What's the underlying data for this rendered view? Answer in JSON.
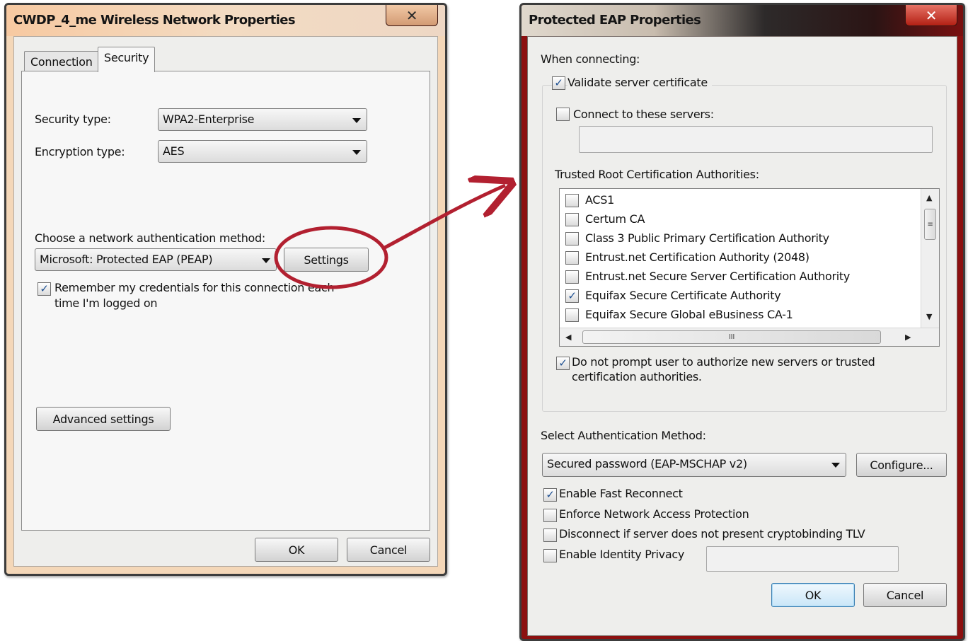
{
  "left_dialog": {
    "title": "CWDP_4_me Wireless Network Properties",
    "close_glyph": "✕",
    "tabs": [
      {
        "label": "Connection"
      },
      {
        "label": "Security"
      }
    ],
    "security_type_label": "Security type:",
    "security_type_value": "WPA2-Enterprise",
    "encryption_type_label": "Encryption type:",
    "encryption_type_value": "AES",
    "auth_method_label": "Choose a network authentication method:",
    "auth_method_value": "Microsoft: Protected EAP (PEAP)",
    "settings_button": "Settings",
    "remember_checkbox": {
      "checked": true,
      "line1": "Remember my credentials for this connection each",
      "line2": "time I'm logged on"
    },
    "advanced_button": "Advanced settings",
    "ok_button": "OK",
    "cancel_button": "Cancel"
  },
  "right_dialog": {
    "title": "Protected EAP Properties",
    "close_glyph": "✕",
    "when_connecting_label": "When connecting:",
    "validate_cert": {
      "checked": true,
      "label": "Validate server certificate"
    },
    "connect_servers": {
      "checked": false,
      "label": "Connect to these servers:"
    },
    "trusted_root_label": "Trusted Root Certification Authorities:",
    "trusted_roots": [
      {
        "label": "ACS1",
        "checked": false
      },
      {
        "label": "Certum CA",
        "checked": false
      },
      {
        "label": "Class 3 Public Primary Certification Authority",
        "checked": false
      },
      {
        "label": "Entrust.net Certification Authority (2048)",
        "checked": false
      },
      {
        "label": "Entrust.net Secure Server Certification Authority",
        "checked": false
      },
      {
        "label": "Equifax Secure Certificate Authority",
        "checked": true
      },
      {
        "label": "Equifax Secure Global eBusiness CA-1",
        "checked": false
      }
    ],
    "scroll_thumb_grip": "III",
    "do_not_prompt": {
      "checked": true,
      "line1": "Do not prompt user to authorize new servers or trusted",
      "line2": "certification authorities."
    },
    "select_auth_label": "Select Authentication Method:",
    "auth_method_value": "Secured password (EAP-MSCHAP v2)",
    "configure_button": "Configure...",
    "options": [
      {
        "label": "Enable Fast Reconnect",
        "checked": true
      },
      {
        "label": "Enforce Network Access Protection",
        "checked": false
      },
      {
        "label": "Disconnect if server does not present cryptobinding TLV",
        "checked": false
      },
      {
        "label": "Enable Identity Privacy",
        "checked": false
      }
    ],
    "ok_button": "OK",
    "cancel_button": "Cancel"
  },
  "annotation": {
    "color": "#b22030"
  }
}
